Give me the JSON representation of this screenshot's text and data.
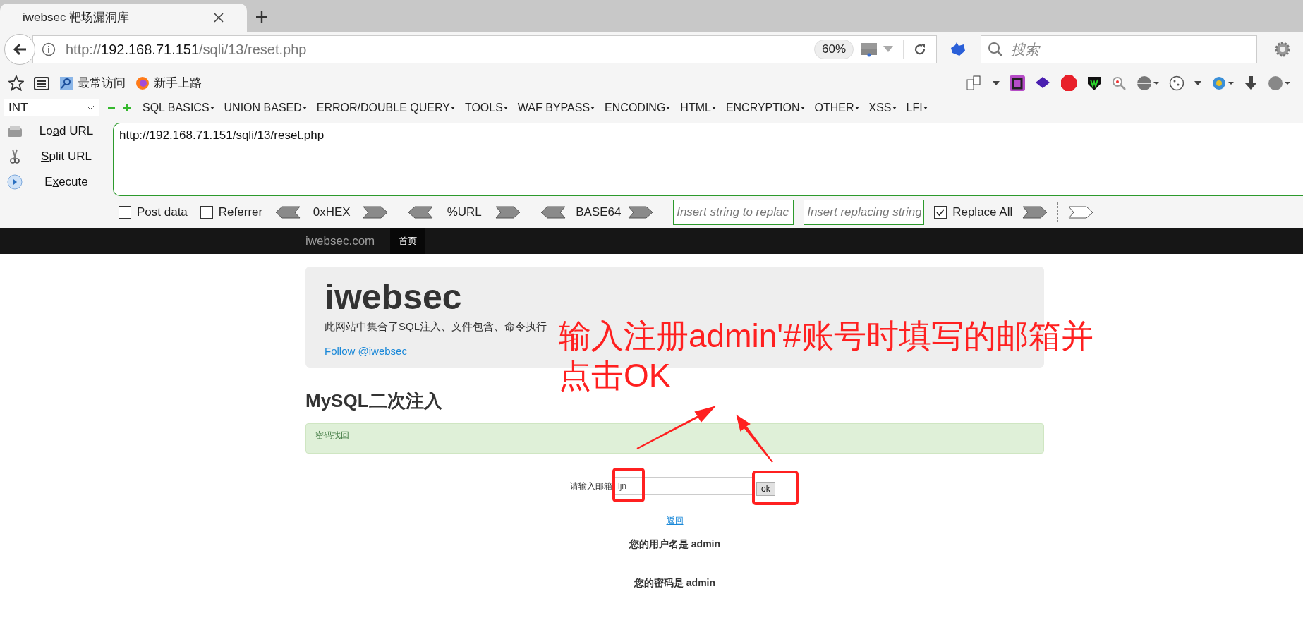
{
  "browser": {
    "tabs": [
      {
        "title": "iwebsec 靶场漏洞库",
        "selected": true
      }
    ],
    "url": {
      "scheme": "http://",
      "host": "192.168.71.151",
      "path": "/sqli/13/reset.php"
    },
    "zoom": "60%",
    "search": {
      "placeholder": "搜索"
    },
    "bookmarks": [
      "最常访问",
      "新手上路"
    ]
  },
  "hackbar": {
    "select": "INT",
    "menus": [
      "SQL BASICS",
      "UNION BASED",
      "ERROR/DOUBLE QUERY",
      "TOOLS",
      "WAF BYPASS",
      "ENCODING",
      "HTML",
      "ENCRYPTION",
      "OTHER",
      "XSS",
      "LFI"
    ],
    "actions": [
      {
        "kind": "load",
        "before": "Lo",
        "key": "a",
        "after": "d URL"
      },
      {
        "kind": "split",
        "key": "S",
        "after": "plit URL"
      },
      {
        "kind": "execute",
        "before": "E",
        "key": "x",
        "after": "ecute"
      }
    ],
    "url_text": "http://192.168.71.151/sqli/13/reset.php",
    "options": [
      {
        "label": "Post data",
        "checked": false
      },
      {
        "label": "Referrer",
        "checked": false
      }
    ],
    "encoders": [
      "0xHEX",
      "%URL",
      "BASE64"
    ],
    "replace_fields": [
      {
        "placeholder": "Insert string to replac"
      },
      {
        "placeholder": "Insert replacing string"
      }
    ],
    "replace_all": {
      "label": "Replace All",
      "checked": true
    }
  },
  "page": {
    "navbar": {
      "brand": "iwebsec.com",
      "links": [
        {
          "label": "首页",
          "selected": true
        }
      ]
    },
    "jumbotron": {
      "title": "iwebsec",
      "description": "此网站中集合了SQL注入、文件包含、命令执行",
      "follow": "Follow @iwebsec"
    },
    "heading": "MySQL二次注入",
    "alert": "密码找回",
    "form": {
      "label": "请输入邮箱",
      "value": "ljn",
      "button": "ok"
    },
    "back_link": "返回",
    "results": [
      "您的用户名是 admin",
      "您的密码是 admin"
    ]
  },
  "annotation": {
    "lines": [
      "输入注册admin'#账号时填写的邮箱并",
      "点击OK"
    ]
  }
}
